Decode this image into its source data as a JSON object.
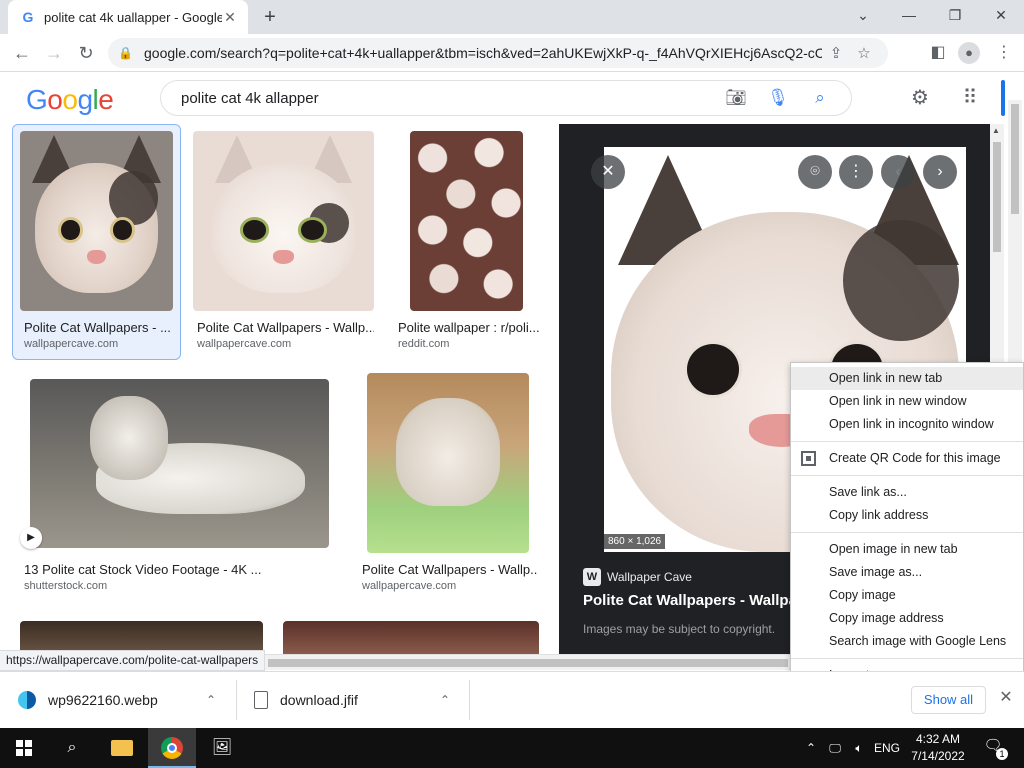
{
  "browser": {
    "tab_title": "polite cat 4k uallapper - Google",
    "tab_favicon": "G",
    "new_tab_label": "+",
    "url": "google.com/search?q=polite+cat+4k+uallapper&tbm=isch&ved=2ahUKEwjXkP-q-_f4AhVQrXIEHcj6AscQ2-cCeg..."
  },
  "search": {
    "query": "polite cat 4k allapper",
    "logo_letters": [
      {
        "ch": "G",
        "color": "#4285f4"
      },
      {
        "ch": "o",
        "color": "#ea4335"
      },
      {
        "ch": "o",
        "color": "#fbbc05"
      },
      {
        "ch": "g",
        "color": "#4285f4"
      },
      {
        "ch": "l",
        "color": "#34a853"
      },
      {
        "ch": "e",
        "color": "#ea4335"
      }
    ]
  },
  "results": [
    {
      "caption": "Polite Cat Wallpapers - ...",
      "source": "wallpapercave.com"
    },
    {
      "caption": "Polite Cat Wallpapers - Wallp...",
      "source": "wallpapercave.com"
    },
    {
      "caption": "Polite wallpaper : r/poli...",
      "source": "reddit.com"
    },
    {
      "caption": "13 Polite cat Stock Video Footage - 4K ...",
      "source": "shutterstock.com"
    },
    {
      "caption": "Polite Cat Wallpapers - Wallp...",
      "source": "wallpapercave.com"
    }
  ],
  "preview": {
    "dimensions": "860 × 1,026",
    "site": "Wallpaper Cave",
    "site_logo": "W",
    "title": "Polite Cat Wallpapers - Wallpap",
    "copyright": "Images may be subject to copyright."
  },
  "context_menu": {
    "open_new_tab": "Open link in new tab",
    "open_new_window": "Open link in new window",
    "open_incognito": "Open link in incognito window",
    "create_qr": "Create QR Code for this image",
    "save_link": "Save link as...",
    "copy_link": "Copy link address",
    "open_image_tab": "Open image in new tab",
    "save_image": "Save image as...",
    "copy_image": "Copy image",
    "copy_image_address": "Copy image address",
    "search_lens": "Search image with Google Lens",
    "inspect": "Inspect"
  },
  "status_bar_url": "https://wallpapercave.com/polite-cat-wallpapers",
  "downloads": {
    "items": [
      {
        "name": "wp9622160.webp"
      },
      {
        "name": "download.jfif"
      }
    ],
    "show_all": "Show all"
  },
  "taskbar": {
    "time": "4:32 AM",
    "date": "7/14/2022",
    "language": "ENG",
    "notification_count": "1"
  }
}
